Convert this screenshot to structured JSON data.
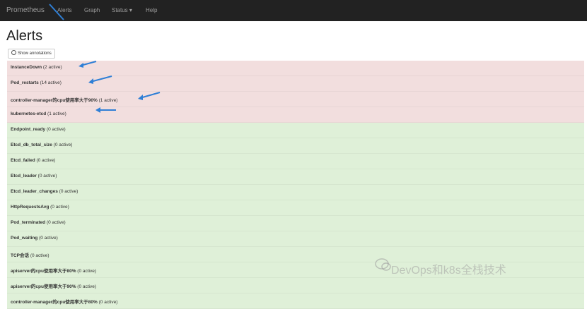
{
  "navbar": {
    "brand": "Prometheus",
    "links": [
      "Alerts",
      "Graph",
      "Status ▾",
      "Help"
    ]
  },
  "page_title": "Alerts",
  "show_annotations_label": "Show annotations",
  "alerts": [
    {
      "name": "InstanceDown",
      "status": "(2 active)",
      "state": "firing"
    },
    {
      "name": "Pod_restarts",
      "status": "(14 active)",
      "state": "firing"
    },
    {
      "name": "controller-manager的cpu使用率大于90%",
      "status": "(1 active)",
      "state": "firing"
    },
    {
      "name": "kubernetes-etcd",
      "status": "(1 active)",
      "state": "firing"
    },
    {
      "name": "Endpoint_ready",
      "status": "(0 active)",
      "state": "inactive"
    },
    {
      "name": "Etcd_db_total_size",
      "status": "(0 active)",
      "state": "inactive"
    },
    {
      "name": "Etcd_failed",
      "status": "(0 active)",
      "state": "inactive"
    },
    {
      "name": "Etcd_leader",
      "status": "(0 active)",
      "state": "inactive"
    },
    {
      "name": "Etcd_leader_changes",
      "status": "(0 active)",
      "state": "inactive"
    },
    {
      "name": "HttpRequestsAvg",
      "status": "(0 active)",
      "state": "inactive"
    },
    {
      "name": "Pod_terminated",
      "status": "(0 active)",
      "state": "inactive"
    },
    {
      "name": "Pod_waiting",
      "status": "(0 active)",
      "state": "inactive"
    },
    {
      "name": "TCP会话",
      "status": "(0 active)",
      "state": "inactive"
    },
    {
      "name": "apiserver的cpu使用率大于80%",
      "status": "(0 active)",
      "state": "inactive"
    },
    {
      "name": "apiserver的cpu使用率大于90%",
      "status": "(0 active)",
      "state": "inactive"
    },
    {
      "name": "controller-manager的cpu使用率大于80%",
      "status": "(0 active)",
      "state": "inactive"
    }
  ],
  "watermark": "DevOps和k8s全栈技术",
  "colors": {
    "firing": "#f2dede",
    "inactive": "#dff0d8",
    "navbar": "#222222",
    "arrow": "#2f7fd6"
  }
}
